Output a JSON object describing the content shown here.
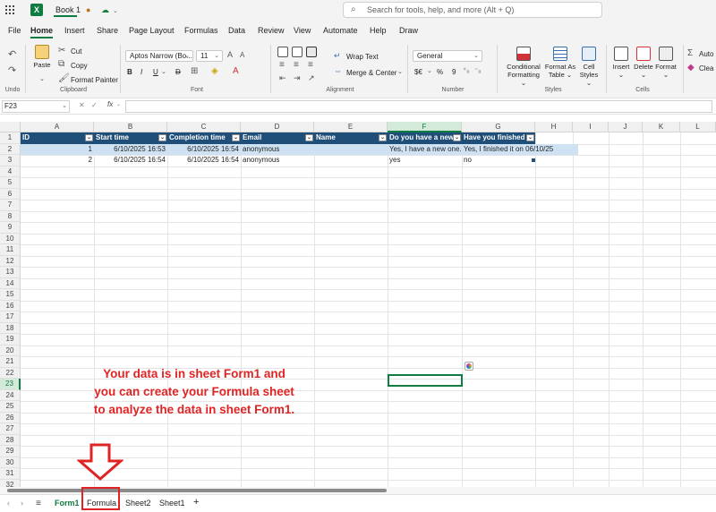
{
  "app": {
    "logo": "X",
    "title": "Book 1",
    "search_placeholder": "Search for tools, help, and more (Alt + Q)"
  },
  "menu": [
    "File",
    "Home",
    "Insert",
    "Share",
    "Page Layout",
    "Formulas",
    "Data",
    "Review",
    "View",
    "Automate",
    "Help",
    "Draw"
  ],
  "ribbon": {
    "undo": "Undo",
    "clipboard": {
      "paste": "Paste",
      "cut": "Cut",
      "copy": "Copy",
      "format_painter": "Format Painter",
      "label": "Clipboard"
    },
    "font": {
      "family": "Aptos Narrow (Bo...",
      "size": "11",
      "bold": "B",
      "italic": "I",
      "underline": "U",
      "strike": "D",
      "label": "Font"
    },
    "alignment": {
      "wrap": "Wrap Text",
      "merge": "Merge & Center",
      "label": "Alignment"
    },
    "number": {
      "format": "General",
      "currency": "$€",
      "percent": "%",
      "comma": "9",
      "label": "Number"
    },
    "styles": {
      "conditional": "Conditional",
      "conditional2": "Formatting",
      "format_as": "Format As",
      "format_as2": "Table",
      "cell": "Cell",
      "cell2": "Styles",
      "label": "Styles"
    },
    "cells": {
      "insert": "Insert",
      "delete": "Delete",
      "format": "Format",
      "label": "Cells"
    },
    "editing": {
      "autosum": "Auto",
      "clear": "Clea"
    }
  },
  "formula_bar": {
    "name_box": "F23",
    "fx": "fx",
    "cancel": "✕",
    "enter": "✓"
  },
  "grid": {
    "columns": [
      "A",
      "B",
      "C",
      "D",
      "E",
      "F",
      "G",
      "H",
      "I",
      "J",
      "K",
      "L"
    ],
    "selected_column": "F",
    "selected_row": "23",
    "headers": [
      "ID",
      "Start time",
      "Completion time",
      "Email",
      "Name",
      "Do you have a new",
      "Have you finished y"
    ],
    "rows": [
      [
        "1",
        "6/10/2025 16:53",
        "6/10/2025 16:54",
        "anonymous",
        "",
        "Yes, I have a new one.",
        "Yes, I finished it on 06/10/25"
      ],
      [
        "2",
        "6/10/2025 16:54",
        "6/10/2025 16:54",
        "anonymous",
        "",
        "yes",
        "no"
      ]
    ]
  },
  "annotation": {
    "line1": "Your data is in sheet Form1 and",
    "line2": "you can create your Formula sheet",
    "line3": "to analyze the data in sheet Form1."
  },
  "sheets": {
    "tabs": [
      "Form1",
      "Formula",
      "Sheet2",
      "Sheet1"
    ],
    "active": "Form1",
    "add": "+"
  },
  "colors": {
    "accent": "#107c41",
    "header_fill": "#1f4e79",
    "annotation": "#e02424"
  }
}
